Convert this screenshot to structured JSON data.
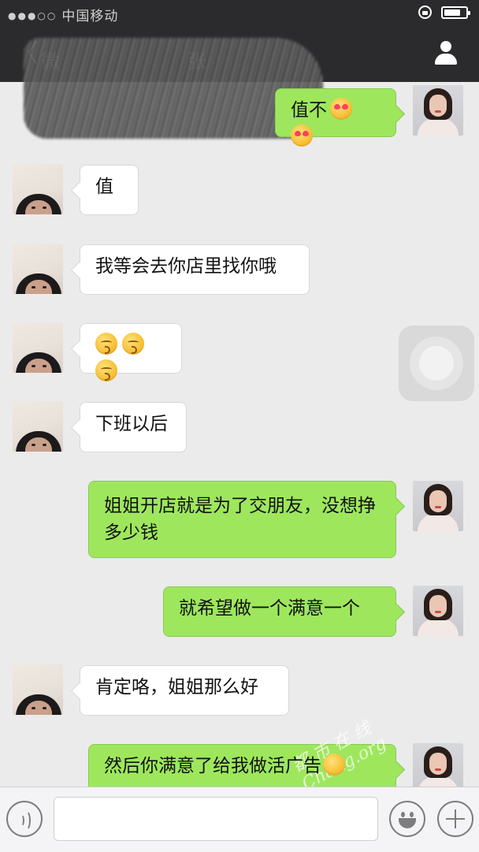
{
  "status_bar": {
    "carrier": "中国移动",
    "battery_level": 0.75
  },
  "nav": {
    "back_label": "微",
    "title": "张"
  },
  "messages": [
    {
      "side": "out",
      "text": "值不",
      "emoji": [
        "smiling-face-heart-eyes-emoji",
        "smiling-face-heart-eyes-emoji"
      ]
    },
    {
      "side": "in",
      "text": "值"
    },
    {
      "side": "in",
      "text": "我等会去你店里找你哦"
    },
    {
      "side": "in",
      "text": "",
      "emoji": [
        "kissing-face-emoji",
        "kissing-face-emoji",
        "kissing-face-emoji"
      ]
    },
    {
      "side": "in",
      "text": "下班以后"
    },
    {
      "side": "out",
      "text": "姐姐开店就是为了交朋友，没想挣多少钱"
    },
    {
      "side": "out",
      "text": "就希望做一个满意一个"
    },
    {
      "side": "in",
      "text": "肯定咯，姐姐那么好"
    },
    {
      "side": "out",
      "text": "然后你满意了给我做活广告",
      "emoji": [
        "smiling-face-emoji"
      ]
    }
  ],
  "input": {
    "placeholder": ""
  },
  "watermark": "都 市 在 线 Chang.org",
  "colors": {
    "outgoing_bubble": "#9ee75d",
    "incoming_bubble": "#ffffff",
    "chat_background": "#ebebeb",
    "nav_background": "#2b2b2d"
  }
}
